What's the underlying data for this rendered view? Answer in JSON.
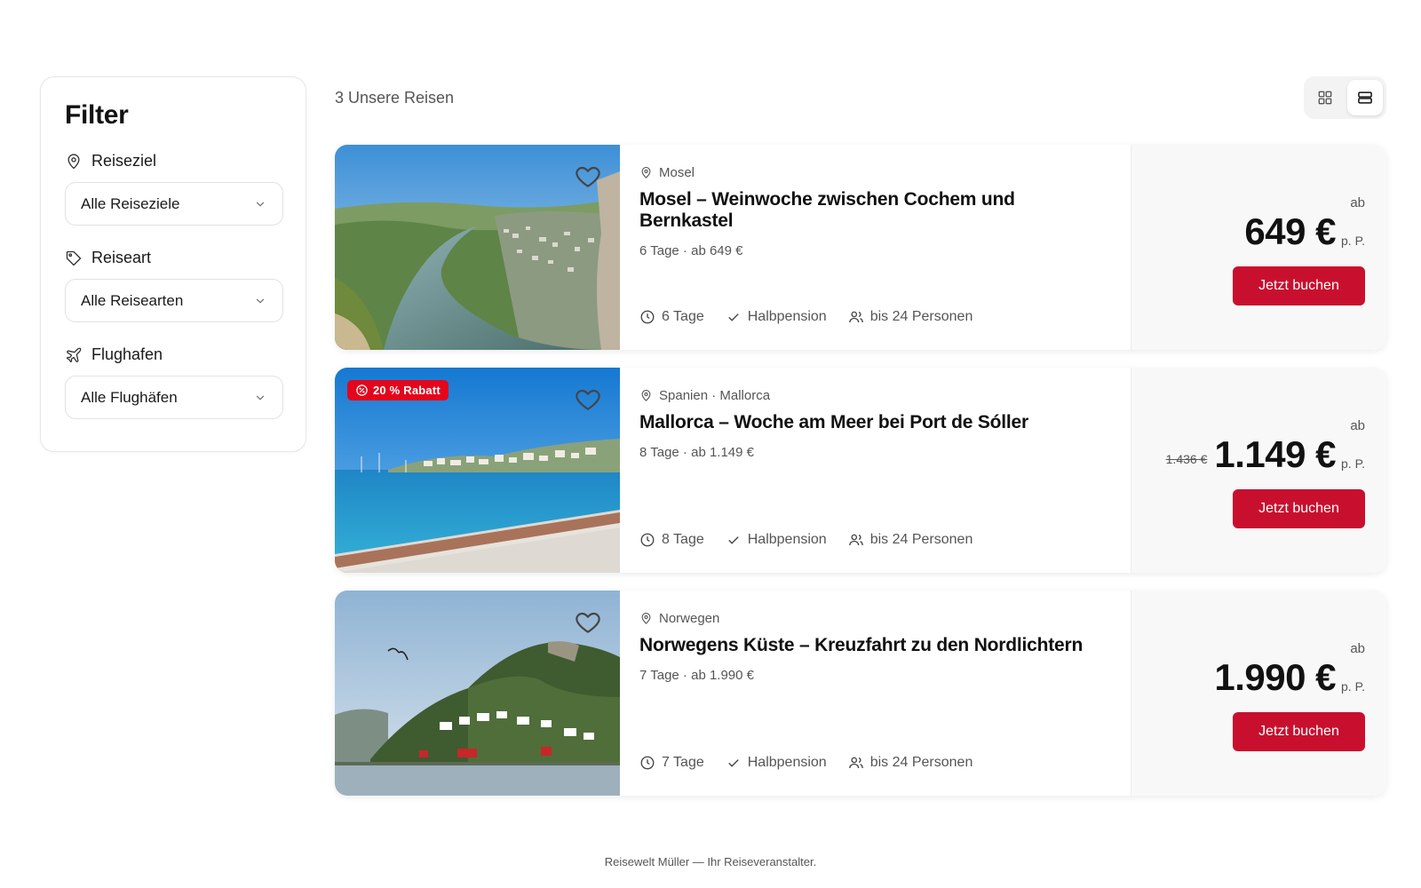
{
  "filter": {
    "title": "Filter",
    "groups": [
      {
        "label": "Reiseziel",
        "icon": "map-pin-icon",
        "value": "Alle Reiseziele"
      },
      {
        "label": "Reiseart",
        "icon": "tag-icon",
        "value": "Alle Reisearten"
      },
      {
        "label": "Flughafen",
        "icon": "plane-icon",
        "value": "Alle Flughäfen"
      }
    ]
  },
  "results": {
    "count_label": "3 Unsere Reisen",
    "view_modes": [
      "grid-view-icon",
      "list-view-icon"
    ],
    "active_view": "list"
  },
  "trips": [
    {
      "location": "Mosel",
      "title": "Mosel – Weinwoche zwischen Cochem und Bernkastel",
      "subtitle": "6 Tage · ab 649 €",
      "duration": "6 Tage",
      "board": "Halbpension",
      "group": "bis 24 Personen",
      "price_prefix": "ab",
      "price": "649 €",
      "per_person": "p. P.",
      "old_price": "",
      "badge": "",
      "book_label": "Jetzt buchen"
    },
    {
      "location": "Spanien · Mallorca",
      "title": "Mallorca – Woche am Meer bei Port de Sóller",
      "subtitle": "8 Tage · ab 1.149 €",
      "duration": "8 Tage",
      "board": "Halbpension",
      "group": "bis 24 Personen",
      "price_prefix": "ab",
      "price": "1.149 €",
      "per_person": "p. P.",
      "old_price": "1.436 €",
      "badge": "20 % Rabatt",
      "book_label": "Jetzt buchen"
    },
    {
      "location": "Norwegen",
      "title": "Norwegens Küste – Kreuzfahrt zu den Nordlichtern",
      "subtitle": "7 Tage · ab 1.990 €",
      "duration": "7 Tage",
      "board": "Halbpension",
      "group": "bis 24 Personen",
      "price_prefix": "ab",
      "price": "1.990 €",
      "per_person": "p. P.",
      "old_price": "",
      "badge": "",
      "book_label": "Jetzt buchen"
    }
  ],
  "footer": {
    "text": "Reisewelt Müller — Ihr Reiseveranstalter."
  },
  "colors": {
    "accent": "#c8102e",
    "badge": "#e3061c",
    "price_panel": "#f8f8f8"
  }
}
